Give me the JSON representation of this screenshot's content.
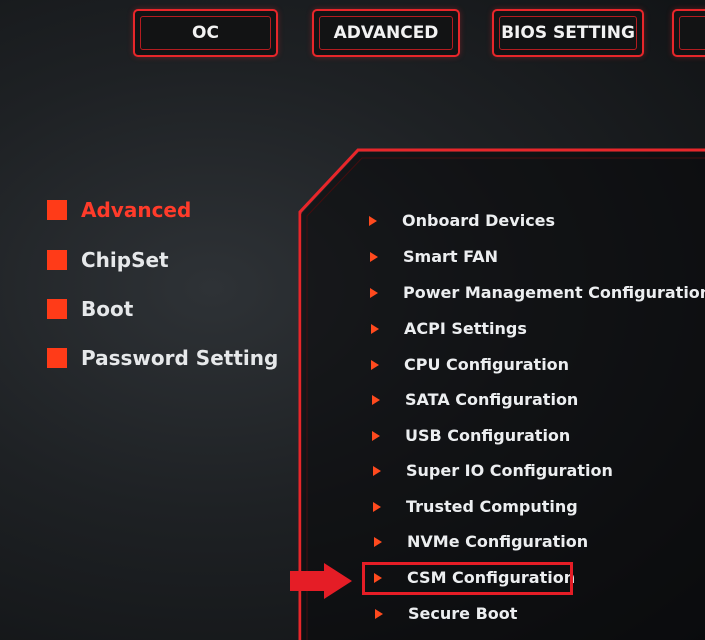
{
  "top_tabs": [
    "OC",
    "ADVANCED",
    "BIOS SETTING"
  ],
  "sidebar": {
    "items": [
      {
        "label": "Advanced",
        "active": true
      },
      {
        "label": "ChipSet",
        "active": false
      },
      {
        "label": "Boot",
        "active": false
      },
      {
        "label": "Password Setting",
        "active": false
      }
    ]
  },
  "menu": {
    "items": [
      "Onboard Devices",
      "Smart FAN",
      "Power Management Configuration",
      "ACPI Settings",
      "CPU Configuration",
      "SATA Configuration",
      "USB Configuration",
      "Super IO Configuration",
      "Trusted Computing",
      "NVMe Configuration",
      "CSM Configuration",
      "Secure Boot"
    ],
    "highlighted": "CSM Configuration"
  },
  "colors": {
    "accent": "#e8262a",
    "bullet": "#ff3b18",
    "text": "#eceef0",
    "annotation": "#e51d26"
  },
  "icons": {
    "menu_bullet": "triangle-right-icon",
    "sidebar_bullet": "square-icon",
    "annotation": "right-arrow-icon"
  }
}
